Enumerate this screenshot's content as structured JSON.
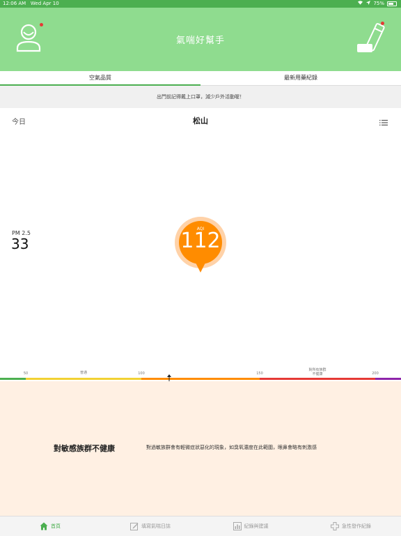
{
  "status": {
    "time": "12:06 AM",
    "date": "Wed Apr 10",
    "battery": "75%"
  },
  "header": {
    "title": "氣喘好幫手"
  },
  "tabs": [
    {
      "label": "空氣品質",
      "active": true
    },
    {
      "label": "最新用藥紀錄",
      "active": false
    }
  ],
  "notice": "出門前記得戴上口罩，減少戶外活動喔！",
  "location_bar": {
    "today": "今日",
    "location": "松山"
  },
  "pm25": {
    "label": "PM 2.5",
    "value": "33"
  },
  "aqi": {
    "label": "AQI",
    "value": "112"
  },
  "scale": {
    "ticks": [
      "50",
      "100",
      "150",
      "200"
    ],
    "labels": [
      "普通",
      "對所有族群\n不健康"
    ],
    "colors": [
      "#4caf50",
      "#f2d233",
      "#ff8c00",
      "#e53935",
      "#8e24aa"
    ]
  },
  "level": {
    "title": "對敏感族群不健康",
    "description": "對過敏族群會有輕微症狀惡化的現象，如臭氧濃度在此範圍，眼鼻會略有刺激感"
  },
  "bottom_nav": [
    {
      "label": "首頁",
      "icon": "home-icon",
      "active": true
    },
    {
      "label": "填寫氣喘日誌",
      "icon": "edit-icon",
      "active": false
    },
    {
      "label": "紀錄與建議",
      "icon": "chart-icon",
      "active": false
    },
    {
      "label": "急性發作紀錄",
      "icon": "cross-icon",
      "active": false
    }
  ]
}
